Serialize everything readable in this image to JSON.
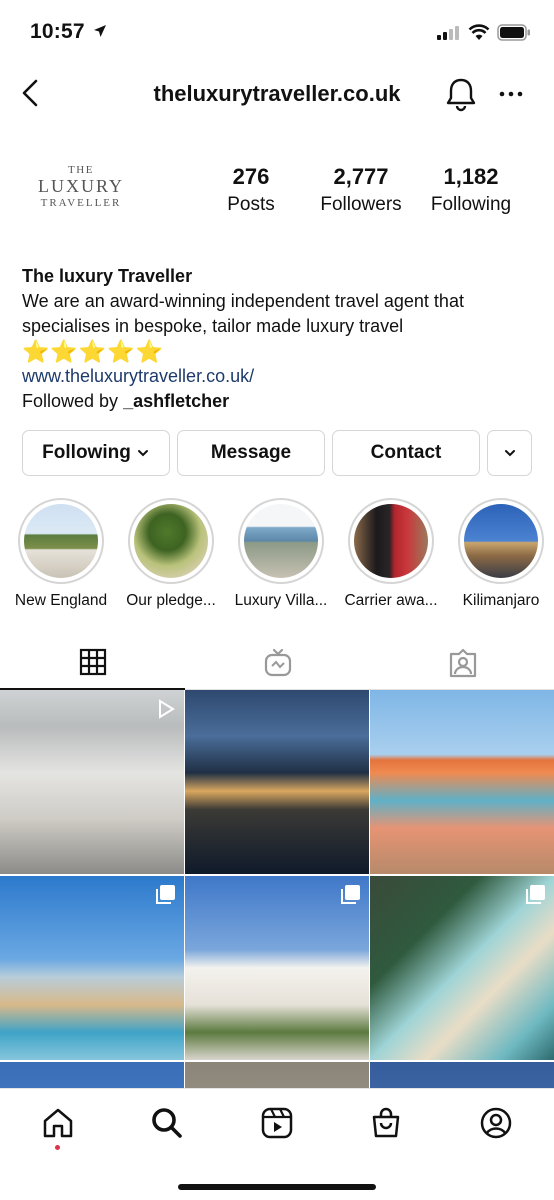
{
  "status_bar": {
    "time": "10:57"
  },
  "header": {
    "username": "theluxurytraveller.co.uk"
  },
  "profile": {
    "logo_lines": [
      "THE",
      "LUXURY",
      "TRAVELLER"
    ],
    "stats": [
      {
        "value": "276",
        "label": "Posts"
      },
      {
        "value": "2,777",
        "label": "Followers"
      },
      {
        "value": "1,182",
        "label": "Following"
      }
    ],
    "bio": {
      "name": "The luxury Traveller",
      "text": "We are an award-winning independent travel agent that specialises in bespoke, tailor made luxury travel",
      "stars": "⭐⭐⭐⭐⭐",
      "link": "www.theluxurytraveller.co.uk/",
      "followed_by_prefix": "Followed by ",
      "followed_by_user": "_ashfletcher"
    }
  },
  "actions": {
    "following": "Following",
    "message": "Message",
    "contact": "Contact"
  },
  "highlights": [
    {
      "label": "New England"
    },
    {
      "label": "Our pledge..."
    },
    {
      "label": "Luxury Villa..."
    },
    {
      "label": "Carrier awa..."
    },
    {
      "label": "Kilimanjaro"
    }
  ],
  "colors": {
    "link": "#1e3a6d",
    "notification_dot": "#e0334c",
    "star": "#f5c518"
  },
  "icons": [
    "back-arrow-icon",
    "bell-icon",
    "more-icon",
    "grid-icon",
    "igtv-icon",
    "tagged-icon",
    "home-icon",
    "search-icon",
    "reels-icon",
    "shop-icon",
    "profile-icon"
  ]
}
